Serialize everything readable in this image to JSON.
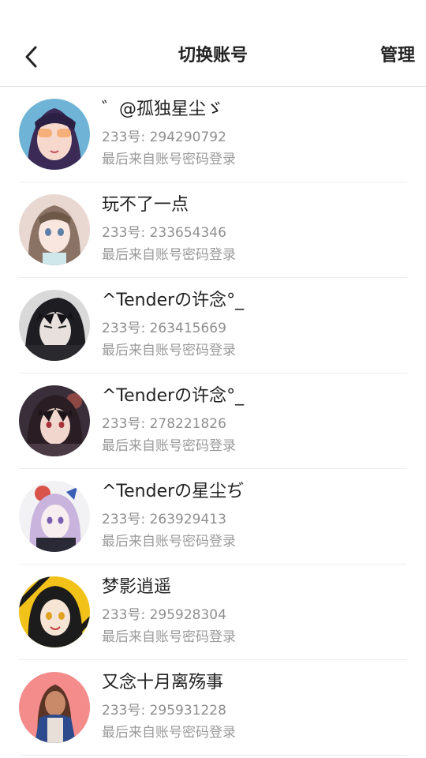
{
  "header": {
    "title": "切换账号",
    "manage_label": "管理"
  },
  "accounts": [
    {
      "name": "゛@孤独星尘ゞ",
      "uid": "233号: 294290792",
      "hint": "最后来自账号密码登录"
    },
    {
      "name": "玩不了一点",
      "uid": "233号: 233654346",
      "hint": "最后来自账号密码登录"
    },
    {
      "name": "^Tenderの许念°_",
      "uid": "233号: 263415669",
      "hint": "最后来自账号密码登录"
    },
    {
      "name": "^Tenderの许念°_",
      "uid": "233号: 278221826",
      "hint": "最后来自账号密码登录"
    },
    {
      "name": "^Tenderの星尘ぢ",
      "uid": "233号: 263929413",
      "hint": "最后来自账号密码登录"
    },
    {
      "name": "梦影逍遥",
      "uid": "233号: 295928304",
      "hint": "最后来自账号密码登录"
    },
    {
      "name": "又念十月离殇事",
      "uid": "233号: 295931228",
      "hint": "最后来自账号密码登录"
    }
  ]
}
